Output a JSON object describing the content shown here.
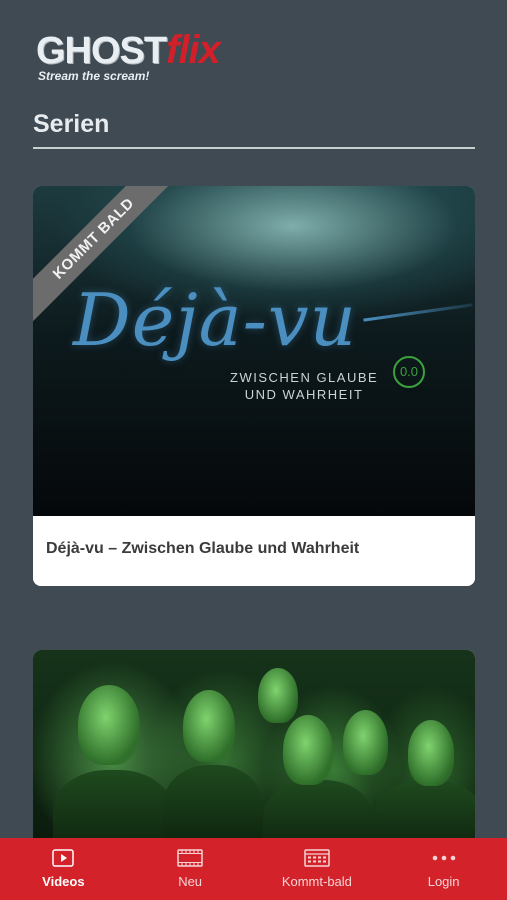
{
  "app": {
    "logo_main": "GHOST",
    "logo_accent": "flix",
    "tagline": "Stream the scream!"
  },
  "page": {
    "title": "Serien"
  },
  "series": [
    {
      "badge": "KOMMT BALD",
      "poster_title": "Déjà-vu",
      "poster_subtitle_1": "ZWISCHEN GLAUBE",
      "poster_subtitle_2": "UND WAHRHEIT",
      "title": "Déjà-vu – Zwischen Glaube und Wahrheit",
      "rating": "0.0"
    }
  ],
  "tabbar": {
    "items": [
      {
        "label": "Videos",
        "icon": "play-icon",
        "active": true
      },
      {
        "label": "Neu",
        "icon": "film-icon",
        "active": false
      },
      {
        "label": "Kommt-bald",
        "icon": "calendar-icon",
        "active": false
      },
      {
        "label": "Login",
        "icon": "more-icon",
        "active": false
      }
    ]
  },
  "colors": {
    "background": "#3f4a52",
    "accent": "#d4222a",
    "rating_green": "#3aa23c"
  }
}
